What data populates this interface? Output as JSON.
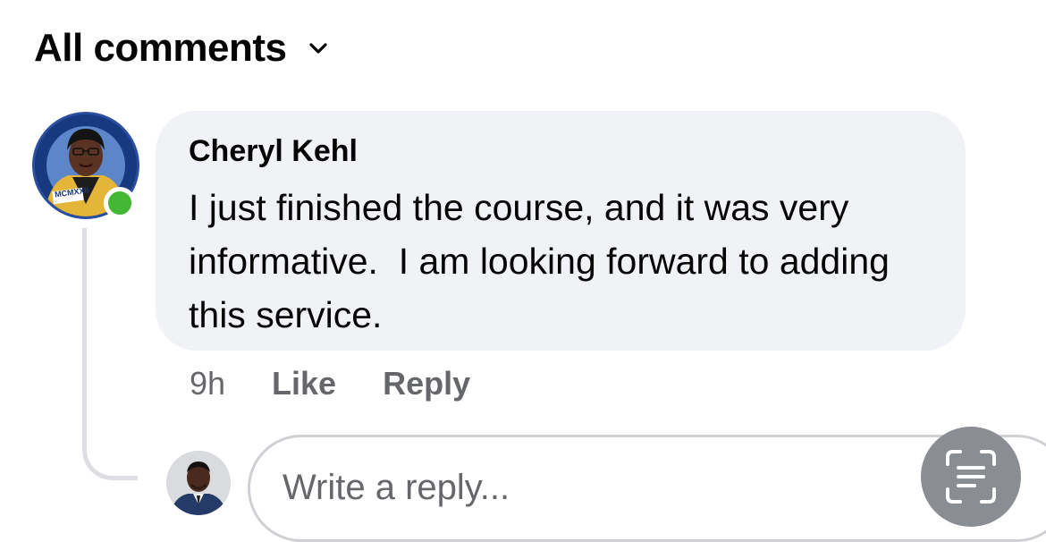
{
  "header": {
    "title": "All comments",
    "dropdown_icon": "chevron-down-icon"
  },
  "comment": {
    "author": "Cheryl Kehl",
    "text": "I just finished the course, and it was very informative.  I am looking forward to adding this service.",
    "time": "9h",
    "like_label": "Like",
    "reply_label": "Reply",
    "avatar_text": "MCMXXII",
    "online": true
  },
  "reply": {
    "placeholder": "Write a reply...",
    "scan_icon": "text-scan-icon"
  },
  "colors": {
    "bubble_bg": "#f0f2f5",
    "meta_text": "#65676b",
    "online_green": "#44b735",
    "scan_button_bg": "#8a8d91"
  }
}
